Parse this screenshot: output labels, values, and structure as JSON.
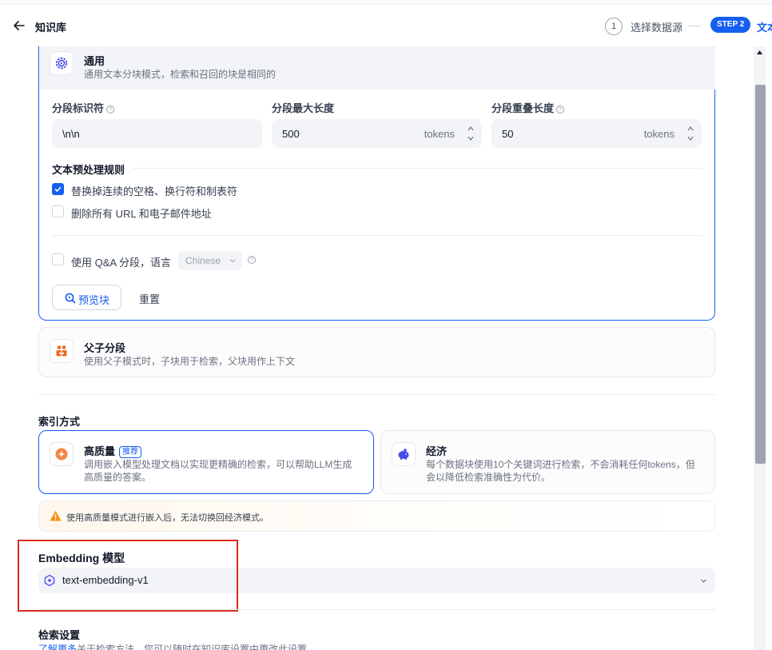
{
  "header": {
    "title": "知识库",
    "step1_number": "1",
    "step1_label": "选择数据源",
    "step2_badge": "STEP 2",
    "step2_label": "文本"
  },
  "general": {
    "title": "通用",
    "desc": "通用文本分块模式，检索和召回的块是相同的",
    "fields": {
      "separator": {
        "label": "分段标识符",
        "value": "\\n\\n"
      },
      "max_length": {
        "label": "分段最大长度",
        "value": "500",
        "unit": "tokens"
      },
      "overlap": {
        "label": "分段重叠长度",
        "value": "50",
        "unit": "tokens"
      }
    },
    "preprocess": {
      "title": "文本预处理规则",
      "rules": [
        {
          "label": "替换掉连续的空格、换行符和制表符",
          "checked": true
        },
        {
          "label": "删除所有 URL 和电子邮件地址",
          "checked": false
        }
      ]
    },
    "qa": {
      "label": "使用 Q&A 分段，语言",
      "checked": false,
      "language": "Chinese"
    },
    "preview_button": "预览块",
    "reset_button": "重置"
  },
  "parent_child": {
    "title": "父子分段",
    "desc": "使用父子模式时，子块用于检索，父块用作上下文"
  },
  "index_method": {
    "title": "索引方式",
    "high_quality": {
      "title": "高质量",
      "tag": "推荐",
      "desc_line1": "调用嵌入模型处理文档以实现更精确的检索，可以帮助LLM生成",
      "desc_line2": "高质量的答案。",
      "selected": true
    },
    "economy": {
      "title": "经济",
      "desc_line1": "每个数据块使用10个关键词进行检索，不会消耗任何tokens，但",
      "desc_line2": "会以降低检索准确性为代价。",
      "selected": false
    },
    "warning": "使用高质量模式进行嵌入后，无法切换回经济模式。"
  },
  "embedding": {
    "title": "Embedding 模型",
    "model": "text-embedding-v1"
  },
  "retrieval": {
    "title": "检索设置",
    "link_text": "了解更多",
    "desc": "关于检索方法，您可以随时在知识库设置中更改此设置。"
  },
  "colors": {
    "accent": "#155eef",
    "highlight_box": "#d92d20",
    "warning_icon": "#f79009"
  }
}
